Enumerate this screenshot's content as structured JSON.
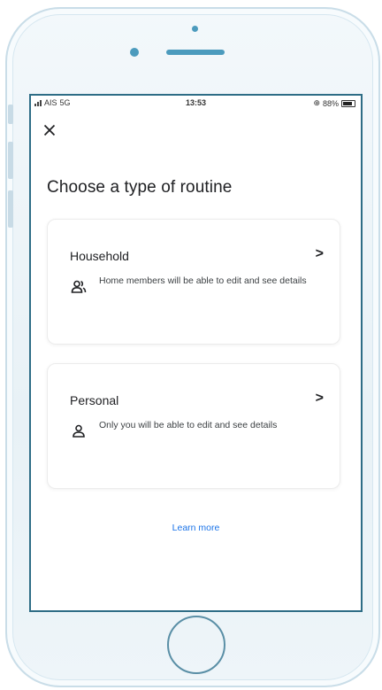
{
  "status_bar": {
    "carrier": "AIS",
    "network": "5G",
    "time": "13:53",
    "battery": "88%"
  },
  "header": {
    "close_icon": "close-icon",
    "title": "Choose a type of routine"
  },
  "options": [
    {
      "title": "Household",
      "description": "Home members will be able to edit and see details",
      "icon": "people-icon",
      "chevron": ">"
    },
    {
      "title": "Personal",
      "description": "Only you will be able to edit and see details",
      "icon": "person-icon",
      "chevron": ">"
    }
  ],
  "footer": {
    "learn_more": "Learn more"
  },
  "colors": {
    "frame_accent": "#4c9bbd",
    "screen_border": "#2e6d86",
    "link": "#1a73e8",
    "text_primary": "#202124"
  }
}
